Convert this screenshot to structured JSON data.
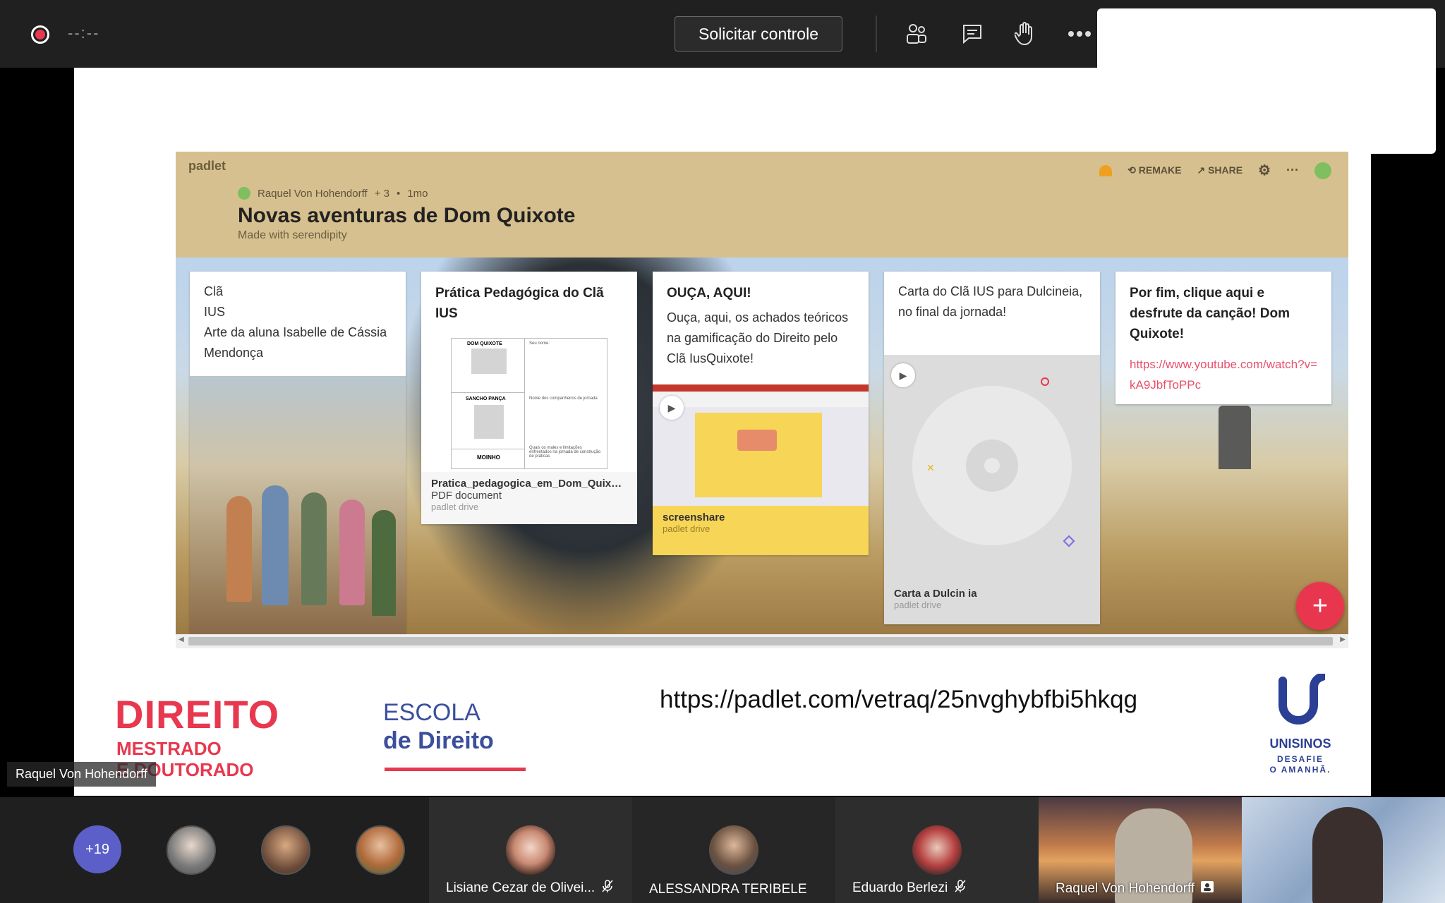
{
  "topbar": {
    "timer": "--:--",
    "request_control": "Solicitar controle",
    "icons": [
      "participants-icon",
      "chat-icon",
      "raise-hand-icon",
      "more-options-icon"
    ]
  },
  "padlet": {
    "logo": "padlet",
    "author": "Raquel Von Hohendorff",
    "contributors": "+ 3",
    "age": "1mo",
    "title": "Novas aventuras de Dom Quixote",
    "subtitle": "Made with serendipity",
    "actions": {
      "remake": "REMAKE",
      "share": "SHARE"
    },
    "cards": {
      "c1": {
        "text": "Clã\n IUS\nArte da aluna Isabelle de Cássia Mendonça"
      },
      "c2": {
        "title": "Prática Pedagógica do Clã IUS",
        "file": "Pratica_pedagogica_em_Dom_Quixote ...",
        "kind": "PDF document",
        "source": "padlet drive"
      },
      "c3": {
        "title": "OUÇA, AQUI!",
        "text": "Ouça, aqui, os achados teóricos na gamificação do Direito pelo Clã IusQuixote!",
        "file": "screenshare",
        "source": "padlet drive"
      },
      "c4": {
        "text": "Carta  do Clã IUS para Dulcineia, no final da jornada!",
        "file": "Carta a Dulcin ia",
        "source": "padlet drive"
      },
      "c5": {
        "title": "Por fim, clique aqui e desfrute da canção! Dom Quixote!",
        "link": "https://www.youtube.com/watch?v=kA9JbfToPPc"
      }
    },
    "doc_preview": {
      "left": [
        "DOM QUIXOTE",
        "SANCHO PANÇA",
        "MOINHO"
      ],
      "right": [
        "Seu nome:",
        "Nome dos companheiros de jornada",
        "Quais os males e limitações enfrentados na jornada de construção de práticas"
      ]
    }
  },
  "slide": {
    "brand": "DIREITO",
    "brand_sub": "MESTRADO\nE DOUTORADO",
    "escola_line1": "ESCOLA",
    "escola_line2": "de Direito",
    "url": "https://padlet.com/vetraq/25nvghybfbi5hkqg",
    "unisinos_name": "UNISINOS",
    "unisinos_tag": "DESAFIE\nO AMANHÃ."
  },
  "speaker": "Raquel Von Hohendorff",
  "participants": {
    "more_count": "+19",
    "tiles": [
      {
        "name": "Lisiane Cezar de Olivei..."
      },
      {
        "name": "ALESSANDRA TERIBELE"
      },
      {
        "name": "Eduardo Berlezi"
      }
    ],
    "videos": [
      {
        "name": "Raquel Von Hohendorff"
      }
    ]
  },
  "colors": {
    "accent": "#e8384f",
    "brand_blue": "#3b4f9c",
    "teams_purple": "#5b5fc7",
    "padlet_header": "#d7c08f"
  }
}
